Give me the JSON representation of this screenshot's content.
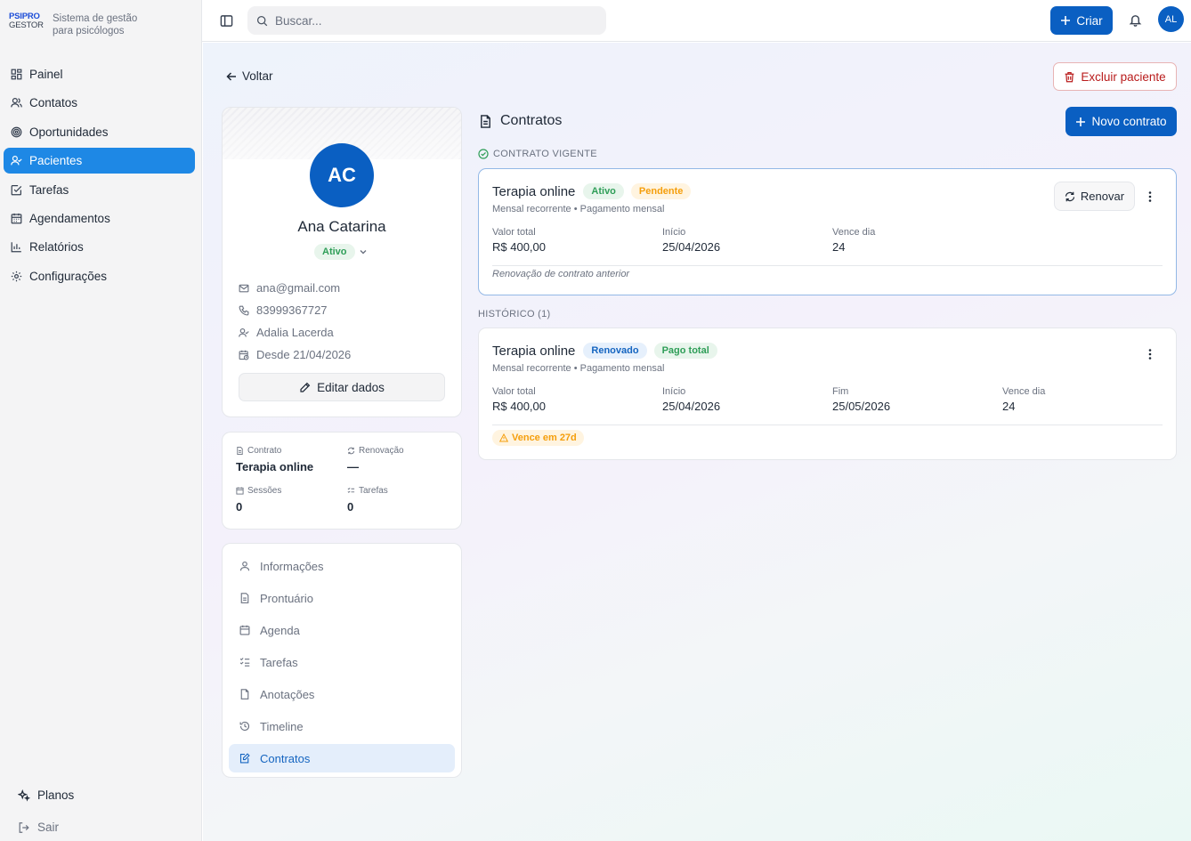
{
  "brand": {
    "logo_line1": "PSIPRO",
    "logo_line2": "GESTOR",
    "tagline_1": "Sistema de gestão",
    "tagline_2": "para psicólogos"
  },
  "sidebar": {
    "items": [
      {
        "label": "Painel",
        "icon": "grid-icon"
      },
      {
        "label": "Contatos",
        "icon": "users-icon"
      },
      {
        "label": "Oportunidades",
        "icon": "target-icon"
      },
      {
        "label": "Pacientes",
        "icon": "user-check-icon",
        "active": true
      },
      {
        "label": "Tarefas",
        "icon": "check-square-icon"
      },
      {
        "label": "Agendamentos",
        "icon": "calendar-icon"
      },
      {
        "label": "Relatórios",
        "icon": "bar-chart-icon"
      },
      {
        "label": "Configurações",
        "icon": "gear-icon"
      }
    ],
    "plans_label": "Planos",
    "logout_label": "Sair"
  },
  "topbar": {
    "search_placeholder": "Buscar...",
    "create_label": "Criar",
    "avatar_initials": "AL"
  },
  "page": {
    "back_label": "Voltar",
    "delete_label": "Excluir paciente"
  },
  "patient": {
    "initials": "AC",
    "name": "Ana Catarina",
    "status": "Ativo",
    "email": "ana@gmail.com",
    "phone": "83999367727",
    "professional": "Adalia Lacerda",
    "since": "Desde 21/04/2026",
    "edit_label": "Editar dados"
  },
  "stats": {
    "contract_label": "Contrato",
    "contract_value": "Terapia online",
    "renewal_label": "Renovação",
    "renewal_value": "—",
    "sessions_label": "Sessões",
    "sessions_value": "0",
    "tasks_label": "Tarefas",
    "tasks_value": "0"
  },
  "tabs": [
    {
      "label": "Informações",
      "icon": "user-icon"
    },
    {
      "label": "Prontuário",
      "icon": "file-text-icon"
    },
    {
      "label": "Agenda",
      "icon": "calendar-icon"
    },
    {
      "label": "Tarefas",
      "icon": "list-checks-icon"
    },
    {
      "label": "Anotações",
      "icon": "file-icon"
    },
    {
      "label": "Timeline",
      "icon": "history-icon"
    },
    {
      "label": "Contratos",
      "icon": "file-edit-icon",
      "active": true
    }
  ],
  "contracts": {
    "title": "Contratos",
    "new_label": "Novo contrato",
    "current_label": "CONTRATO VIGENTE",
    "history_label": "HISTÓRICO (1)",
    "current": {
      "name": "Terapia online",
      "badge1": "Ativo",
      "badge2": "Pendente",
      "subtitle": "Mensal recorrente • Pagamento mensal",
      "renew_label": "Renovar",
      "total_label": "Valor total",
      "total_value": "R$ 400,00",
      "start_label": "Início",
      "start_value": "25/04/2026",
      "due_label": "Vence dia",
      "due_value": "24",
      "note": "Renovação de contrato anterior"
    },
    "history": [
      {
        "name": "Terapia online",
        "badge1": "Renovado",
        "badge2": "Pago total",
        "subtitle": "Mensal recorrente • Pagamento mensal",
        "total_label": "Valor total",
        "total_value": "R$ 400,00",
        "start_label": "Início",
        "start_value": "25/04/2026",
        "end_label": "Fim",
        "end_value": "25/05/2026",
        "due_label": "Vence dia",
        "due_value": "24",
        "warning": "Vence em 27d"
      }
    ]
  },
  "colors": {
    "primary": "#0a5fc2",
    "sidebar_active": "#1e88e5",
    "success": "#2f9e58",
    "warning": "#f59e0b",
    "danger": "#b91c1c"
  }
}
